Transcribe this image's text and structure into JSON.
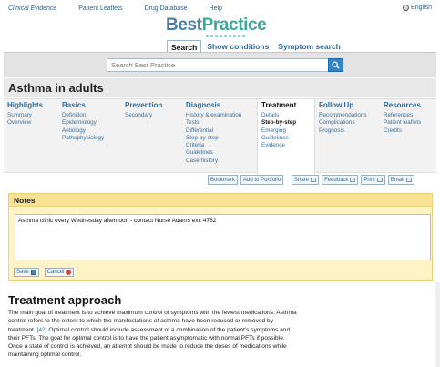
{
  "top_links": [
    "Clinical Evidence",
    "Patient Leaflets",
    "Drug Database",
    "Help"
  ],
  "language": "English",
  "logo": {
    "part1": "Best",
    "part2": "Practice"
  },
  "search_tabs": [
    {
      "label": "Search",
      "active": true
    },
    {
      "label": "Show conditions",
      "active": false
    },
    {
      "label": "Symptom search",
      "active": false
    }
  ],
  "search": {
    "placeholder": "Search Best Practice",
    "button_icon": "search-icon"
  },
  "page_title": "Asthma in adults",
  "menu": {
    "highlights": {
      "heading": "Highlights",
      "items": [
        "Summary",
        "Overview"
      ]
    },
    "basics": {
      "heading": "Basics",
      "items": [
        "Definition",
        "Epidemiology",
        "Aetiology",
        "Pathophysiology"
      ]
    },
    "prevention": {
      "heading": "Prevention",
      "items": [
        "Secondary"
      ]
    },
    "diagnosis": {
      "heading": "Diagnosis",
      "items": [
        "History & examination",
        "Tests",
        "Differential",
        "Step-by-step",
        "Criteria",
        "Guidelines",
        "Case history"
      ]
    },
    "treatment": {
      "heading": "Treatment",
      "items": [
        "Details",
        "Step-by-step",
        "Emerging",
        "Guidelines",
        "Evidence"
      ],
      "current": "Step-by-step"
    },
    "followup": {
      "heading": "Follow Up",
      "items": [
        "Recommendations",
        "Complications",
        "Prognosis"
      ]
    },
    "resources": {
      "heading": "Resources",
      "items": [
        "References",
        "Patient leaflets",
        "Credits"
      ]
    }
  },
  "tools": {
    "bookmark": "Bookmark",
    "portfolio": "Add to Portfolio",
    "share": "Share",
    "feedback": "Feedback",
    "print": "Print",
    "email": "Email"
  },
  "notes": {
    "heading": "Notes",
    "text": "Asthma clinic every Wednesday afternoon - contact Nurse Adams ext. 4762",
    "save": "Save",
    "cancel": "Cancel"
  },
  "section": {
    "title": "Treatment approach",
    "para_a": "The main goal of treatment is to achieve maximum control of symptoms with the fewest medications. Asthma control refers to the extent to which the manifestations of asthma have been reduced or removed by treatment. ",
    "ref": "[42]",
    "para_b": " Optimal control should include assessment of a combination of the patient's symptoms and their PFTs. The goal for optimal control is to have the patient asymptomatic with normal PFTs if possible. Once a state of control is achieved, an attempt should be made to reduce the doses of medications while maintaining optimal control."
  }
}
